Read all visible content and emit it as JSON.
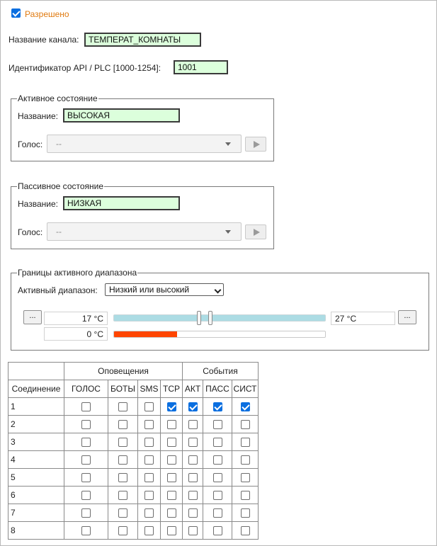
{
  "enabled": {
    "label": "Разрешено",
    "checked": true
  },
  "channel": {
    "label": "Название канала:",
    "value": "ТЕМПЕРАТ_КОМНАТЫ"
  },
  "api": {
    "label": "Идентификатор API / PLC [1000-1254]:",
    "value": "1001"
  },
  "active_state": {
    "legend": "Активное состояние",
    "name_label": "Название:",
    "name_value": "ВЫСОКАЯ",
    "voice_label": "Голос:",
    "voice_value": "--"
  },
  "passive_state": {
    "legend": "Пассивное состояние",
    "name_label": "Название:",
    "name_value": "НИЗКАЯ",
    "voice_label": "Голос:",
    "voice_value": "--"
  },
  "range": {
    "legend": "Границы активного диапазона",
    "mode_label": "Активный диапазон:",
    "mode_value": "Низкий или высокий",
    "low_button": "...",
    "high_button": "...",
    "low_value": "17 °C",
    "high_value": "27 °C",
    "current_value": "0 °C",
    "level_fraction": 0.3
  },
  "table": {
    "group_notifications": "Оповещения",
    "group_events": "События",
    "headers": [
      "Соединение",
      "ГОЛОС",
      "БОТЫ",
      "SMS",
      "TCP",
      "АКТ",
      "ПАСС",
      "СИСТ"
    ],
    "rows": [
      {
        "id": "1",
        "checks": [
          false,
          false,
          false,
          true,
          true,
          true,
          true
        ]
      },
      {
        "id": "2",
        "checks": [
          false,
          false,
          false,
          false,
          false,
          false,
          false
        ]
      },
      {
        "id": "3",
        "checks": [
          false,
          false,
          false,
          false,
          false,
          false,
          false
        ]
      },
      {
        "id": "4",
        "checks": [
          false,
          false,
          false,
          false,
          false,
          false,
          false
        ]
      },
      {
        "id": "5",
        "checks": [
          false,
          false,
          false,
          false,
          false,
          false,
          false
        ]
      },
      {
        "id": "6",
        "checks": [
          false,
          false,
          false,
          false,
          false,
          false,
          false
        ]
      },
      {
        "id": "7",
        "checks": [
          false,
          false,
          false,
          false,
          false,
          false,
          false
        ]
      },
      {
        "id": "8",
        "checks": [
          false,
          false,
          false,
          false,
          false,
          false,
          false
        ]
      }
    ]
  },
  "colors": {
    "enabled_label": "#e07a10",
    "input_bg": "#dcffdc",
    "slider_track": "#acdce4",
    "level_fill": "#ff4500",
    "checkbox_on": "#0b6fe0"
  }
}
